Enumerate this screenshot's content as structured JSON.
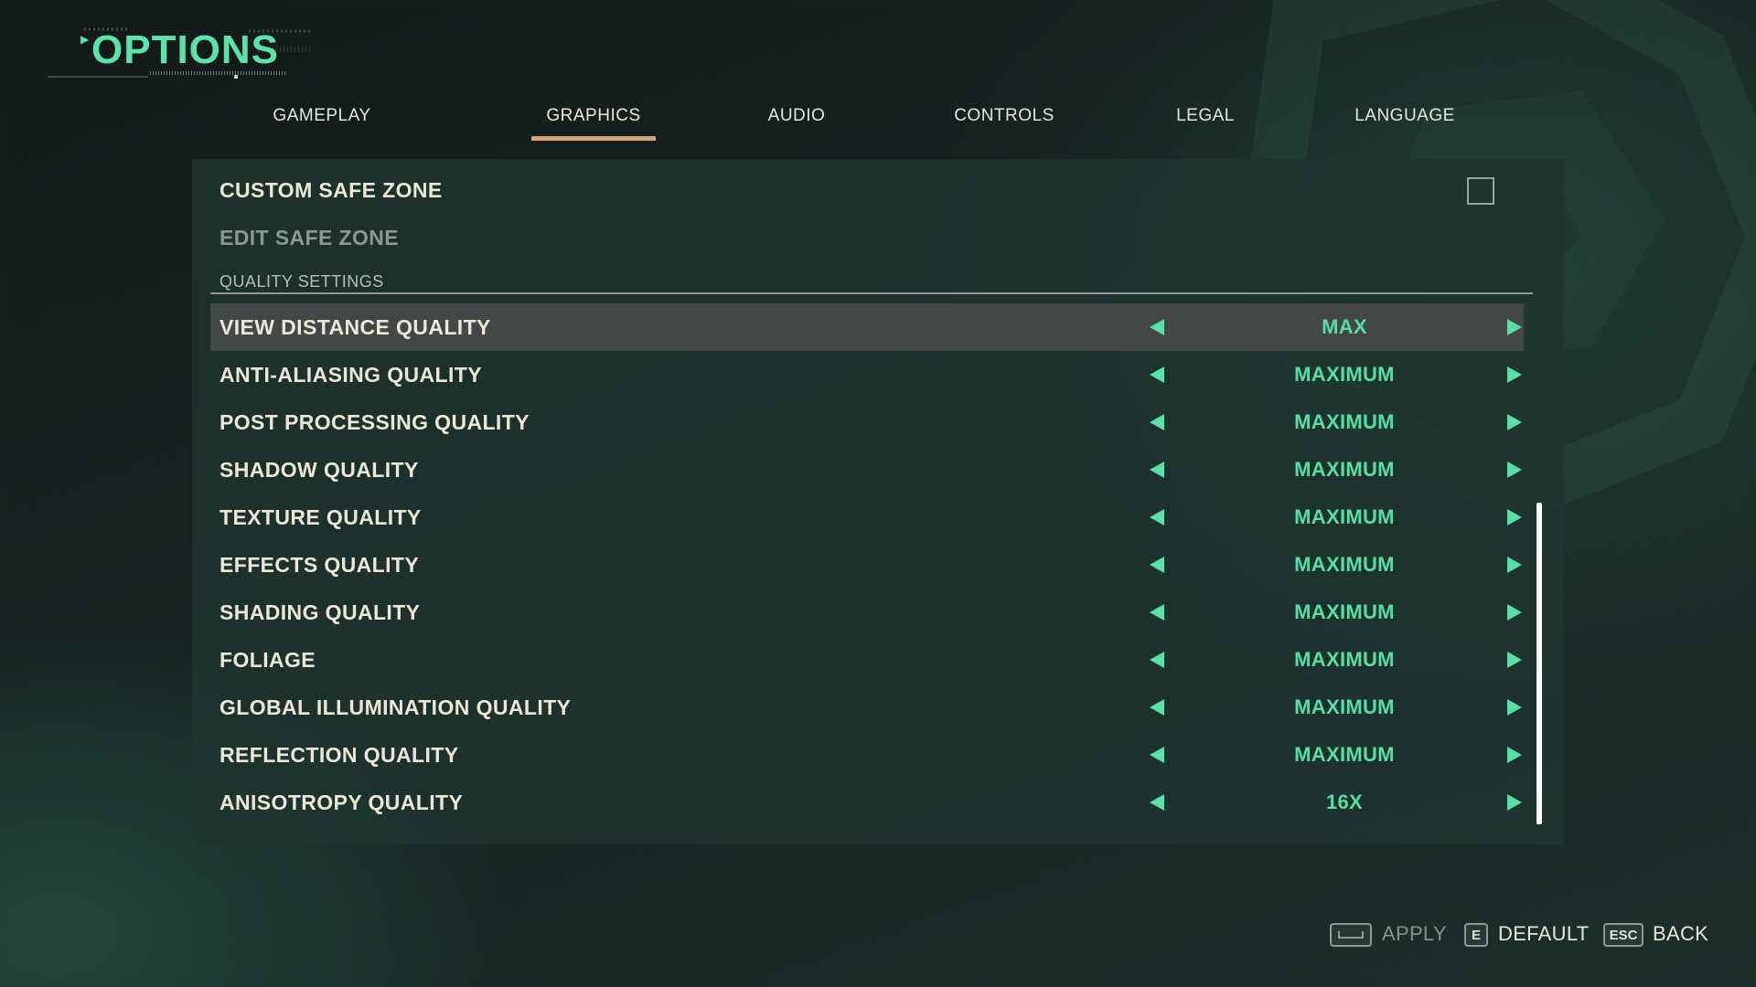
{
  "header": {
    "title": "OPTIONS"
  },
  "tabs": [
    {
      "label": "GAMEPLAY"
    },
    {
      "label": "GRAPHICS",
      "active": true
    },
    {
      "label": "AUDIO"
    },
    {
      "label": "CONTROLS"
    },
    {
      "label": "LEGAL"
    },
    {
      "label": "LANGUAGE"
    }
  ],
  "settings": {
    "custom_safe_zone": {
      "label": "CUSTOM SAFE ZONE",
      "checked": false
    },
    "edit_safe_zone": {
      "label": "EDIT SAFE ZONE"
    },
    "section_title": "QUALITY SETTINGS",
    "quality_rows": [
      {
        "label": "VIEW DISTANCE QUALITY",
        "value": "MAX"
      },
      {
        "label": "ANTI-ALIASING QUALITY",
        "value": "MAXIMUM"
      },
      {
        "label": "POST PROCESSING QUALITY",
        "value": "MAXIMUM"
      },
      {
        "label": "SHADOW QUALITY",
        "value": "MAXIMUM"
      },
      {
        "label": "TEXTURE QUALITY",
        "value": "MAXIMUM"
      },
      {
        "label": "EFFECTS QUALITY",
        "value": "MAXIMUM"
      },
      {
        "label": "SHADING QUALITY",
        "value": "MAXIMUM"
      },
      {
        "label": "FOLIAGE",
        "value": "MAXIMUM"
      },
      {
        "label": "GLOBAL ILLUMINATION QUALITY",
        "value": "MAXIMUM"
      },
      {
        "label": "REFLECTION QUALITY",
        "value": "MAXIMUM"
      },
      {
        "label": "ANISOTROPY QUALITY",
        "value": "16X"
      }
    ]
  },
  "footer": {
    "apply": {
      "key": "space-bar-key-icon",
      "label": "APPLY"
    },
    "default": {
      "key": "E",
      "label": "DEFAULT"
    },
    "back": {
      "key": "ESC",
      "label": "BACK"
    }
  },
  "colors": {
    "accent_green": "#56dfa4",
    "tab_underline": "#d3a67a",
    "selected_row": "#434846",
    "panel_bg": "#1f342f"
  }
}
